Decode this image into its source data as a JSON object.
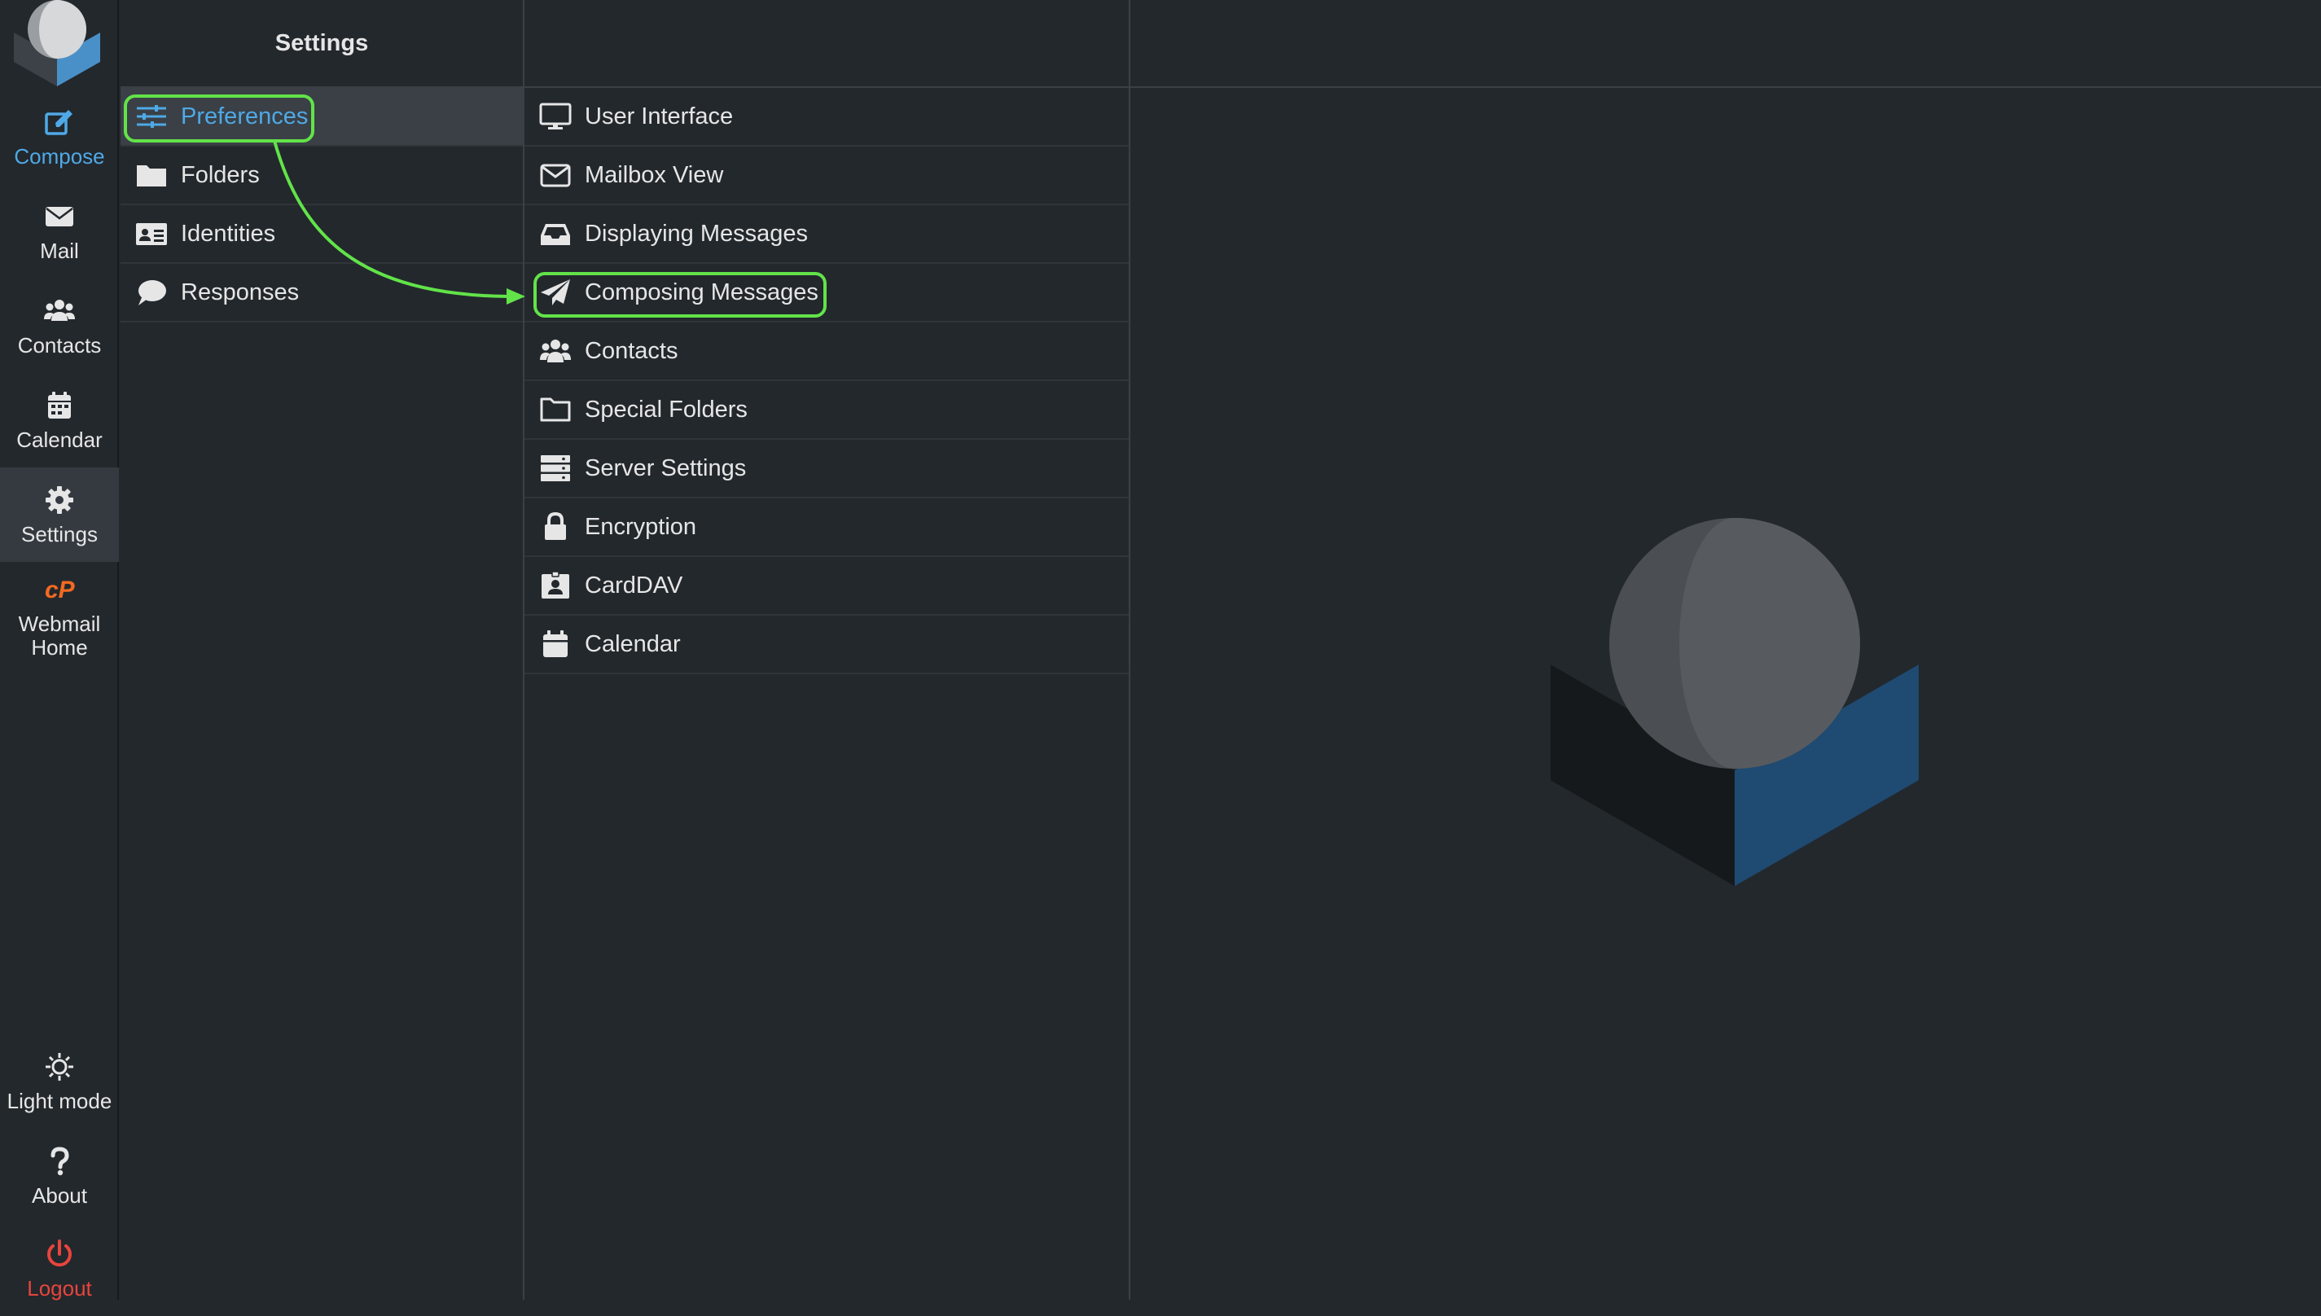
{
  "nav": {
    "items": [
      {
        "label": "Compose",
        "icon": "compose-icon"
      },
      {
        "label": "Mail",
        "icon": "envelope-icon"
      },
      {
        "label": "Contacts",
        "icon": "users-icon"
      },
      {
        "label": "Calendar",
        "icon": "calendar-icon"
      },
      {
        "label": "Settings",
        "icon": "gear-icon"
      },
      {
        "label": "Webmail Home",
        "icon": "cpanel-icon"
      }
    ],
    "bottom": [
      {
        "label": "Light mode",
        "icon": "sun-icon"
      },
      {
        "label": "About",
        "icon": "question-icon"
      },
      {
        "label": "Logout",
        "icon": "power-icon"
      }
    ]
  },
  "settings": {
    "title": "Settings",
    "items": [
      {
        "label": "Preferences",
        "icon": "sliders-icon"
      },
      {
        "label": "Folders",
        "icon": "folder-icon"
      },
      {
        "label": "Identities",
        "icon": "id-card-icon"
      },
      {
        "label": "Responses",
        "icon": "comment-icon"
      }
    ]
  },
  "sections": {
    "items": [
      {
        "label": "User Interface",
        "icon": "monitor-icon"
      },
      {
        "label": "Mailbox View",
        "icon": "envelope-outline-icon"
      },
      {
        "label": "Displaying Messages",
        "icon": "inbox-icon"
      },
      {
        "label": "Composing Messages",
        "icon": "paper-plane-icon"
      },
      {
        "label": "Contacts",
        "icon": "users-icon"
      },
      {
        "label": "Special Folders",
        "icon": "folder-outline-icon"
      },
      {
        "label": "Server Settings",
        "icon": "server-icon"
      },
      {
        "label": "Encryption",
        "icon": "lock-icon"
      },
      {
        "label": "CardDAV",
        "icon": "address-card-icon"
      },
      {
        "label": "Calendar",
        "icon": "calendar-icon"
      }
    ]
  },
  "colors": {
    "background": "#23282d",
    "accent": "#4fa9e6",
    "highlight": "#62e349",
    "logout": "#e8453c"
  }
}
